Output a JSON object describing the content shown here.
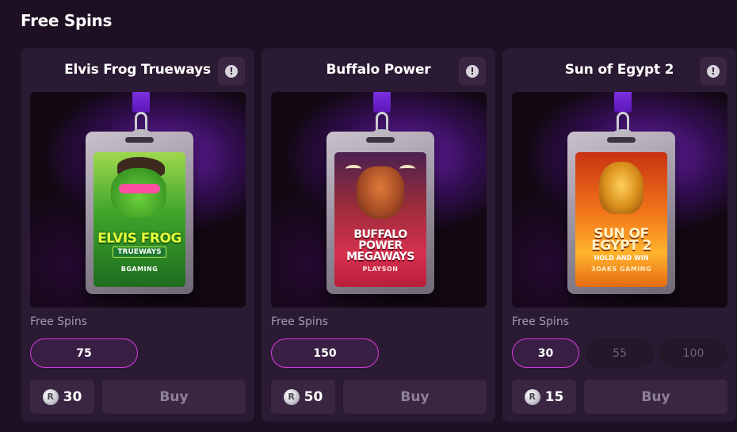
{
  "page": {
    "title": "Free Spins"
  },
  "cards": [
    {
      "title": "Elvis Frog Trueways",
      "info_icon": "!",
      "game_art": {
        "name": "Elvis Frog",
        "tag": "TRUEWAYS",
        "provider": "BGAMING"
      },
      "free_spins_label": "Free Spins",
      "spin_options": [
        {
          "value": "75",
          "selected": true
        }
      ],
      "price": "30",
      "coin_icon": "R",
      "buy_label": "Buy"
    },
    {
      "title": "Buffalo Power",
      "info_icon": "!",
      "game_art": {
        "name": "Buffalo Power Megaways",
        "provider": "PLAYSON"
      },
      "free_spins_label": "Free Spins",
      "spin_options": [
        {
          "value": "150",
          "selected": true
        }
      ],
      "price": "50",
      "coin_icon": "R",
      "buy_label": "Buy"
    },
    {
      "title": "Sun of Egypt 2",
      "info_icon": "!",
      "game_art": {
        "name": "Sun of Egypt 2",
        "tag": "HOLD AND WIN",
        "provider": "3OAKS GAMING"
      },
      "free_spins_label": "Free Spins",
      "spin_options": [
        {
          "value": "30",
          "selected": true
        },
        {
          "value": "55",
          "selected": false
        },
        {
          "value": "100",
          "selected": false
        }
      ],
      "price": "15",
      "coin_icon": "R",
      "buy_label": "Buy"
    }
  ],
  "colors": {
    "background": "#1d1023",
    "card": "#2b1a33",
    "button": "#3a2642",
    "accent": "#d93ae0",
    "muted_text": "#a79aae"
  }
}
